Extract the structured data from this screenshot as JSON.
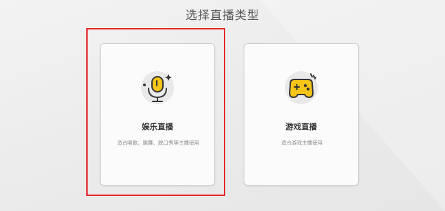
{
  "page": {
    "title": "选择直播类型"
  },
  "cards": [
    {
      "id": "entertainment",
      "title": "娱乐直播",
      "description": "适合唱歌、跳舞、脱口秀等主播使用",
      "icon": "microphone-icon",
      "selected": true
    },
    {
      "id": "gaming",
      "title": "游戏直播",
      "description": "适合游戏主播使用",
      "icon": "gamepad-icon",
      "selected": false
    }
  ],
  "colors": {
    "accent": "#f5c518",
    "selection_border": "#e2262b",
    "icon_bg": "#e9e9e9",
    "icon_stroke": "#333333"
  }
}
